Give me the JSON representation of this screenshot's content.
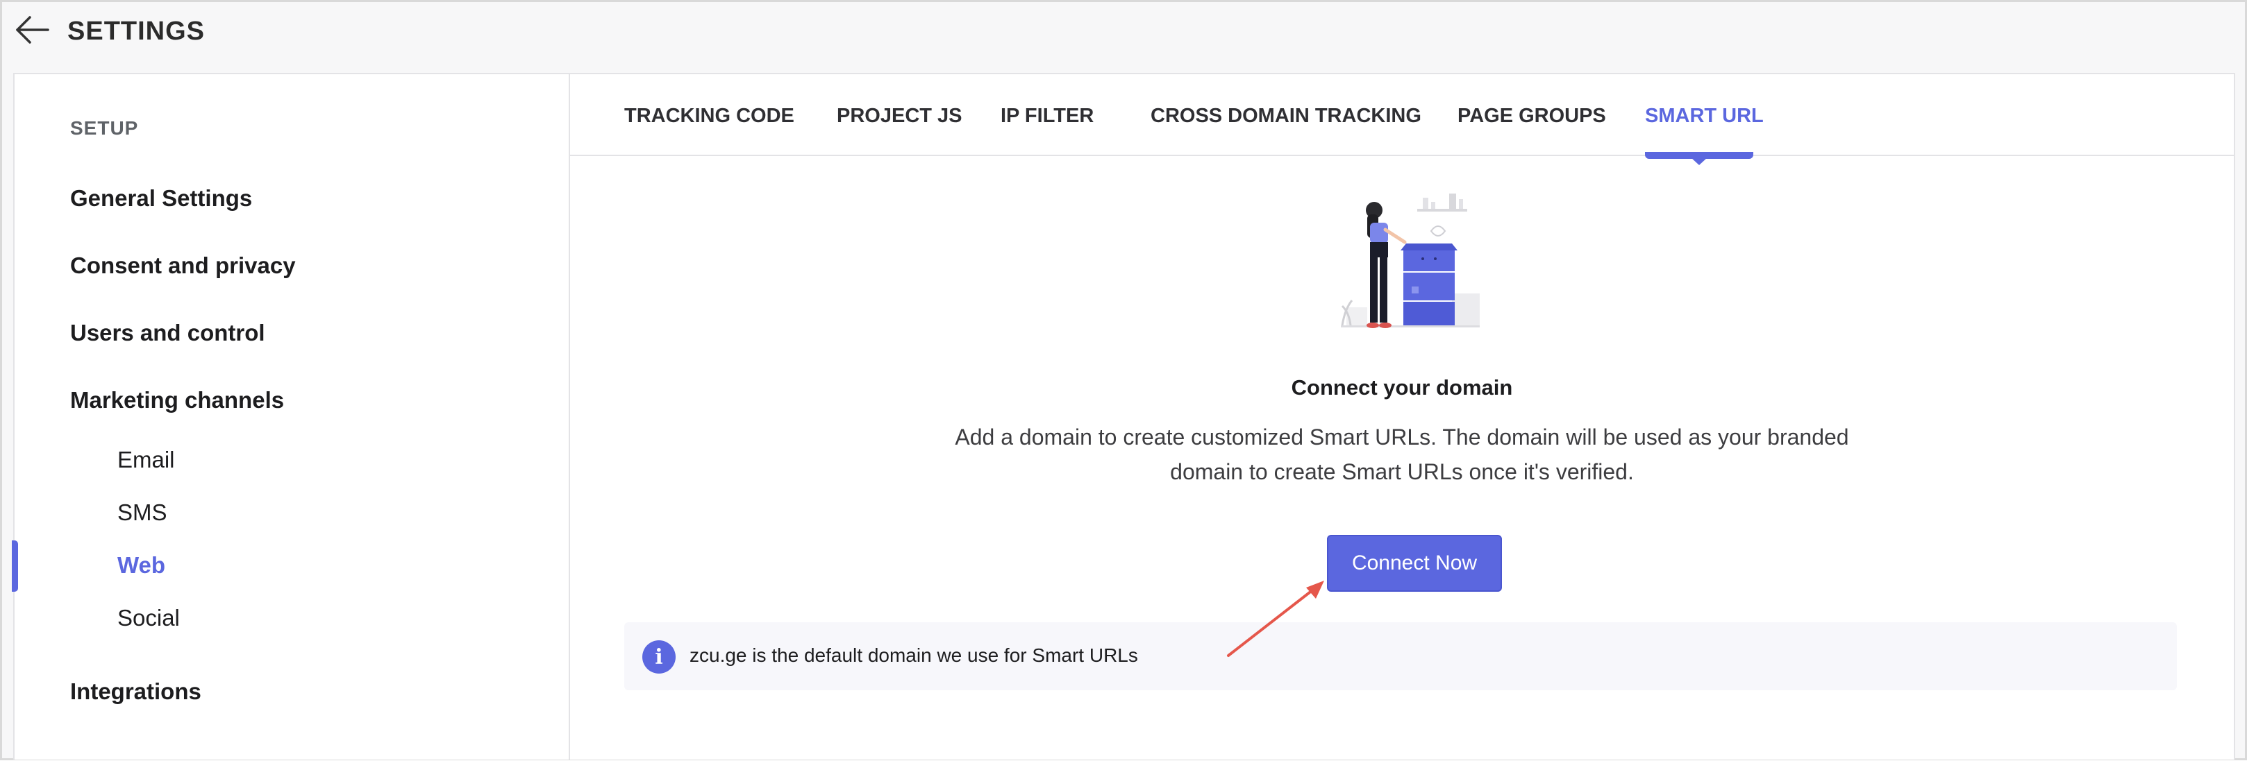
{
  "header": {
    "title": "SETTINGS",
    "back_icon": "arrow-left-icon"
  },
  "sidebar": {
    "section": "SETUP",
    "items": [
      {
        "label": "General Settings"
      },
      {
        "label": "Consent and privacy"
      },
      {
        "label": "Users and control"
      },
      {
        "label": "Marketing channels"
      }
    ],
    "sub_items": [
      {
        "label": "Email"
      },
      {
        "label": "SMS"
      },
      {
        "label": "Web",
        "active": true
      },
      {
        "label": "Social"
      }
    ],
    "bottom_item": {
      "label": "Integrations"
    }
  },
  "tabs": [
    {
      "label": "TRACKING CODE"
    },
    {
      "label": "PROJECT JS"
    },
    {
      "label": "IP FILTER"
    },
    {
      "label": "CROSS DOMAIN TRACKING"
    },
    {
      "label": "PAGE GROUPS"
    },
    {
      "label": "SMART URL",
      "active": true
    }
  ],
  "main": {
    "title": "Connect your domain",
    "description_line1": "Add a domain to create customized Smart URLs. The domain will be used as your branded",
    "description_line2": "domain to create Smart URLs once it's verified.",
    "button_label": "Connect Now",
    "info_text": "zcu.ge is the default domain we use for Smart URLs",
    "info_icon": "info-icon"
  },
  "colors": {
    "accent": "#5b67df",
    "annotation_arrow": "#e5574b"
  }
}
